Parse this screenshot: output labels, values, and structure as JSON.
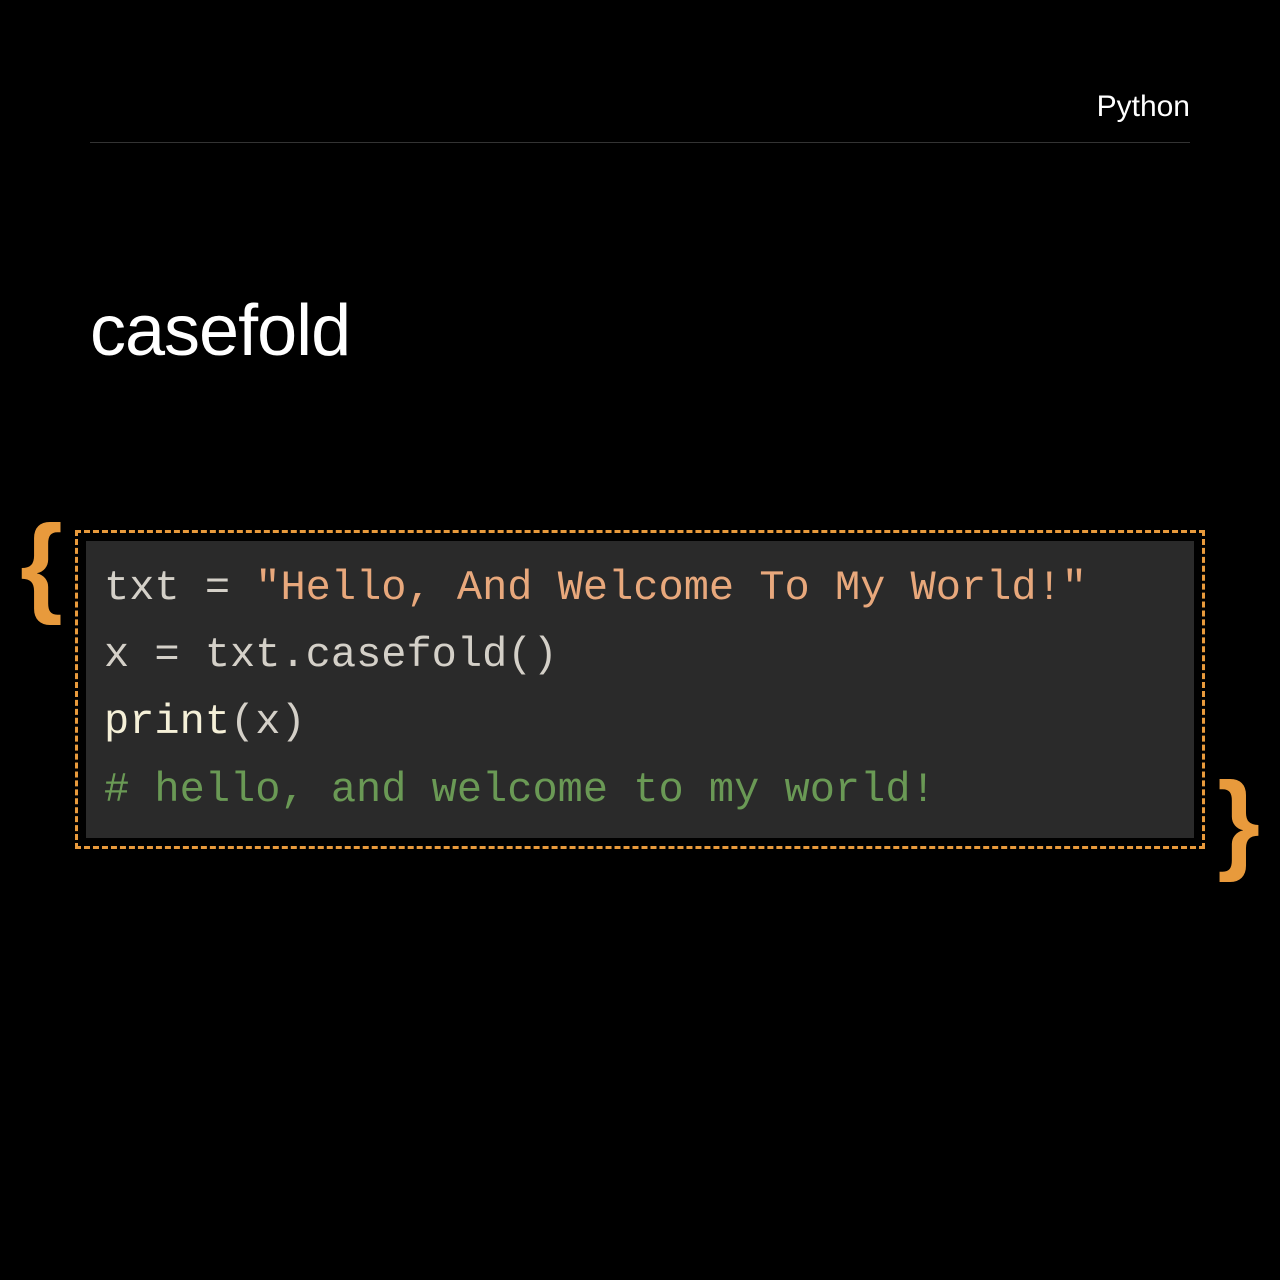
{
  "header": {
    "language": "Python"
  },
  "title": "casefold",
  "code": {
    "line1_var": "txt",
    "line1_op": " = ",
    "line1_string": "\"Hello, And Welcome To My World!\"",
    "line2_var": "x",
    "line2_op": " = ",
    "line2_expr": "txt.casefold()",
    "line3_func": "print",
    "line3_open": "(",
    "line3_arg": "x",
    "line3_close": ")",
    "line4_comment": "# hello, and welcome to my world!"
  },
  "braces": {
    "left": "{",
    "right": "}"
  }
}
